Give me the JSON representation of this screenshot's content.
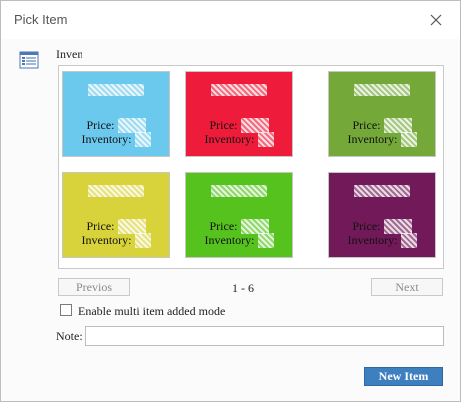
{
  "window": {
    "title": "Pick Item",
    "close_icon": "close-icon",
    "app_icon": "document-list-icon"
  },
  "section_label": "Inventory",
  "tiles": [
    {
      "color": "#6cc9ee",
      "price_label": "Price:",
      "inventory_label": "Inventory:"
    },
    {
      "color": "#ee1c3a",
      "price_label": "Price:",
      "inventory_label": "Inventory:"
    },
    {
      "color": "#74a93a",
      "price_label": "Price:",
      "inventory_label": "Inventory:"
    },
    {
      "color": "#d8d33a",
      "price_label": "Price:",
      "inventory_label": "Inventory:"
    },
    {
      "color": "#55c21e",
      "price_label": "Price:",
      "inventory_label": "Inventory:"
    },
    {
      "color": "#721a59",
      "price_label": "Price:",
      "inventory_label": "Inventory:"
    }
  ],
  "pager": {
    "previous_label": "Previos",
    "range": "1 - 6",
    "next_label": "Next"
  },
  "multi_mode": {
    "label": "Enable multi item added mode",
    "checked": false
  },
  "note": {
    "label": "Note:",
    "value": ""
  },
  "new_item_label": "New Item"
}
